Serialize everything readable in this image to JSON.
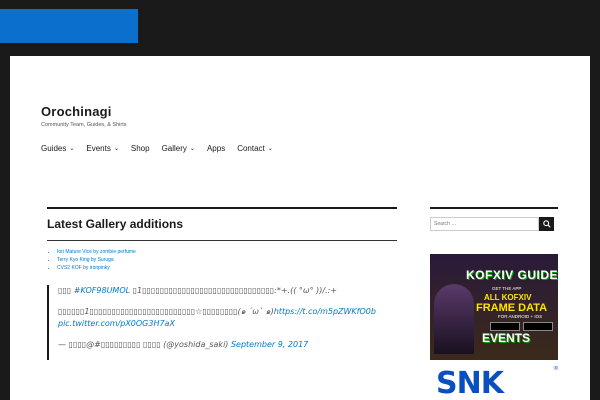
{
  "site": {
    "title": "Orochinagi",
    "description": "Community Team, Guides, & Shirts"
  },
  "nav": {
    "items": [
      {
        "label": "Guides",
        "has_dropdown": true
      },
      {
        "label": "Events",
        "has_dropdown": true
      },
      {
        "label": "Shop",
        "has_dropdown": false
      },
      {
        "label": "Gallery",
        "has_dropdown": true
      },
      {
        "label": "Apps",
        "has_dropdown": false
      },
      {
        "label": "Contact",
        "has_dropdown": true
      }
    ],
    "chevron": "⌄"
  },
  "main": {
    "section_title": "Latest Gallery additions",
    "gallery": [
      {
        "label": "Iori Mature Vice by zombie perfume"
      },
      {
        "label": "Terry Kyo King by Suruga"
      },
      {
        "label": "CVS2 KOF by ironpinky"
      }
    ]
  },
  "tweet": {
    "line1_prefix": "▯▯▯ ",
    "line1_hashtag": "#KOF98UMOL",
    "line1_suffix": " ▯1▯▯▯▯▯▯▯▯▯▯▯▯▯▯▯▯▯▯▯▯▯▯▯▯▯▯▯▯▯▯:*+.(( °ω° ))/.:+",
    "line2_text": "▯▯▯▯▯▯1▯▯▯▯▯▯▯▯▯▯▯▯▯▯▯▯▯▯▯▯▯▯▯▯☆▯▯▯▯▯▯▯▯(๑ ´ω` ๑)",
    "line2_link": "https://t.co/m5pZWKfO0b",
    "line3_link": "pic.twitter.com/pX0OG3H7aX",
    "byline_prefix": "— ▯▯▯▯@#▯▯▯▯▯▯▯▯▯ ▯▯▯▯ (@yoshida_saki) ",
    "byline_date": "September 9, 2017"
  },
  "sidebar": {
    "search_placeholder": "Search …",
    "promo": {
      "title": "KOFXIV GUIDE",
      "get_app": "GET THE APP",
      "all_kofxiv": "ALL KOFXIV",
      "frame_data": "FRAME DATA",
      "platforms": "FOR ANDROID + IOS",
      "events": "EVENTS"
    },
    "sponsor": {
      "logo": "SNK",
      "reg": "®"
    }
  },
  "colors": {
    "accent": "#0b6fce",
    "link": "#007acc",
    "background": "#1a1a1a",
    "page": "#ffffff",
    "snk_blue": "#0a4fbf"
  }
}
